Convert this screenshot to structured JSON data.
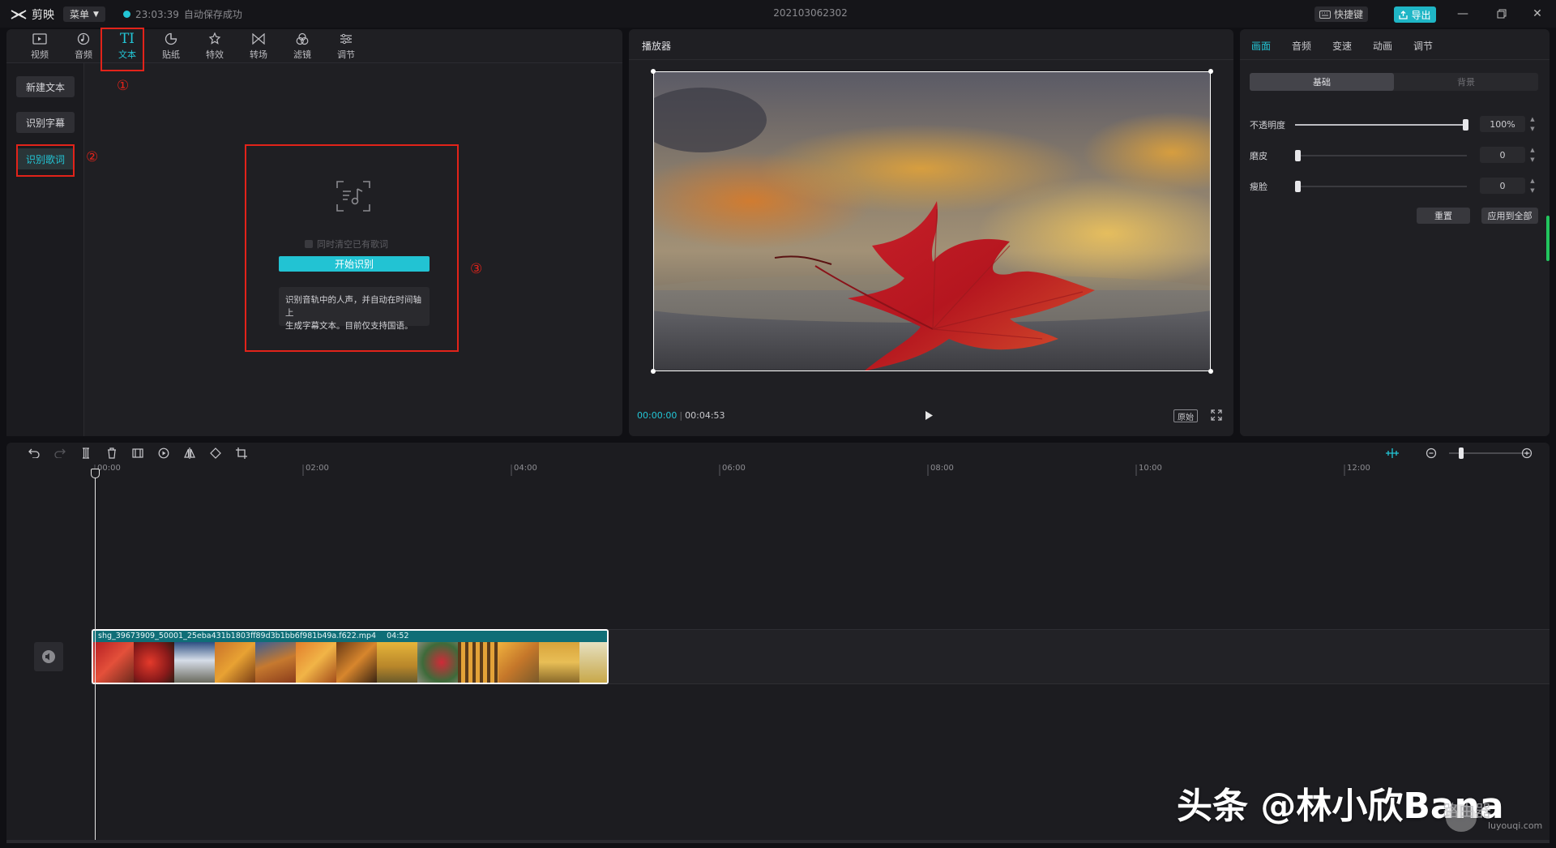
{
  "app": {
    "title": "剪映",
    "menu_label": "菜单",
    "save_time": "23:03:39",
    "save_status": "自动保存成功",
    "project_name": "202103062302",
    "shortcut_label": "快捷键",
    "export_label": "导出",
    "accent_color": "#23c6d6",
    "annotation_color": "#e2231a"
  },
  "toolbar": {
    "items": [
      {
        "label": "视频",
        "icon": "video-icon"
      },
      {
        "label": "音频",
        "icon": "audio-icon"
      },
      {
        "label": "文本",
        "icon": "text-icon",
        "active": true
      },
      {
        "label": "贴纸",
        "icon": "sticker-icon"
      },
      {
        "label": "特效",
        "icon": "effects-icon"
      },
      {
        "label": "转场",
        "icon": "transition-icon"
      },
      {
        "label": "滤镜",
        "icon": "filter-icon"
      },
      {
        "label": "调节",
        "icon": "adjust-icon"
      }
    ]
  },
  "sidebar": {
    "items": [
      {
        "label": "新建文本"
      },
      {
        "label": "识别字幕"
      },
      {
        "label": "识别歌词",
        "active": true
      }
    ]
  },
  "annotations": {
    "one": "①",
    "two": "②",
    "three": "③"
  },
  "lyrics_panel": {
    "checkbox_label": "同时清空已有歌词",
    "start_button": "开始识别",
    "tip_line1": "识别音轨中的人声，并自动在时间轴上",
    "tip_line2": "生成字幕文本。目前仅支持国语。"
  },
  "player": {
    "title": "播放器",
    "current_time": "00:00:00",
    "total_time": "00:04:53",
    "ratio_label": "原始"
  },
  "inspector": {
    "tabs": [
      {
        "label": "画面",
        "active": true
      },
      {
        "label": "音频"
      },
      {
        "label": "变速"
      },
      {
        "label": "动画"
      },
      {
        "label": "调节"
      }
    ],
    "segments": {
      "basic": "基础",
      "background": "背景"
    },
    "params": [
      {
        "label": "不透明度",
        "value": "100%",
        "level": 1.0
      },
      {
        "label": "磨皮",
        "value": "0",
        "level": 0.0
      },
      {
        "label": "瘦脸",
        "value": "0",
        "level": 0.0
      }
    ],
    "reset_label": "重置",
    "apply_all_label": "应用到全部"
  },
  "timeline": {
    "ticks": [
      "00:00",
      "02:00",
      "04:00",
      "06:00",
      "08:00",
      "10:00",
      "12:00"
    ],
    "clip_name": "shg_39673909_50001_25eba431b1803ff89d3b1bb6f981b49a.f622.mp4",
    "clip_duration": "04:52"
  },
  "watermark": {
    "main": "头条 @林小欣Bana",
    "site_name": "路由器",
    "site_url": "luyouqi.com"
  }
}
